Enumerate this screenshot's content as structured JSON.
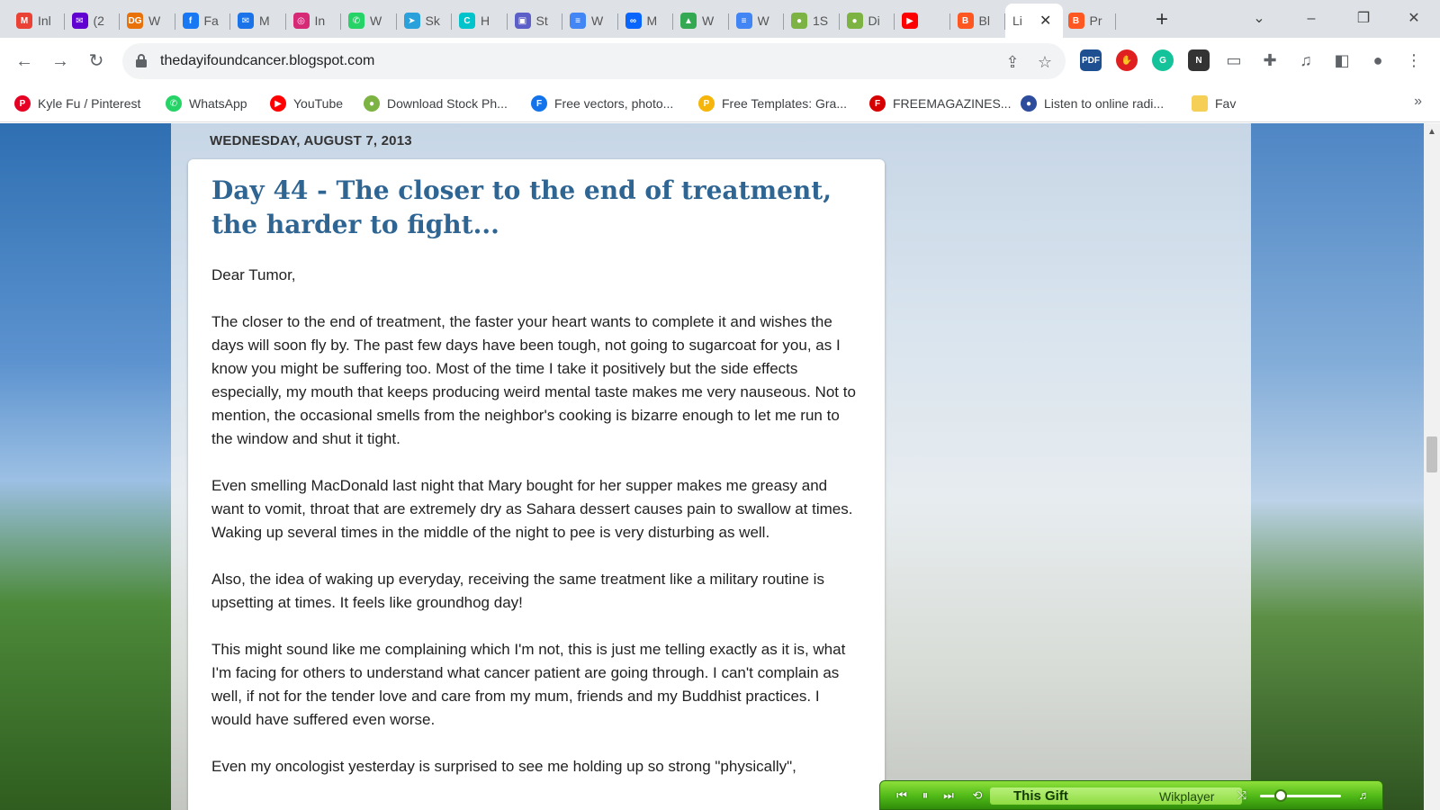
{
  "browser": {
    "tabs": [
      {
        "title": "Inl",
        "icon": "gmail-icon",
        "color": "#ea4335",
        "glyph": "M"
      },
      {
        "title": "(2",
        "icon": "yahoo-mail-icon",
        "color": "#6001d2",
        "glyph": "✉"
      },
      {
        "title": "W",
        "icon": "dg-icon",
        "color": "#e8710a",
        "glyph": "DG"
      },
      {
        "title": "Fa",
        "icon": "facebook-icon",
        "color": "#1877f2",
        "glyph": "f"
      },
      {
        "title": "M",
        "icon": "mail-icon",
        "color": "#1a73e8",
        "glyph": "✉"
      },
      {
        "title": "In",
        "icon": "instagram-icon",
        "color": "#d62976",
        "glyph": "◎"
      },
      {
        "title": "W",
        "icon": "whatsapp-icon",
        "color": "#25d366",
        "glyph": "✆"
      },
      {
        "title": "Sk",
        "icon": "telegram-icon",
        "color": "#2aa1da",
        "glyph": "➤"
      },
      {
        "title": "H",
        "icon": "canva-icon",
        "color": "#00c4cc",
        "glyph": "C"
      },
      {
        "title": "St",
        "icon": "image-icon",
        "color": "#5b5fc7",
        "glyph": "▣"
      },
      {
        "title": "W",
        "icon": "docs-icon",
        "color": "#4285f4",
        "glyph": "≡"
      },
      {
        "title": "M",
        "icon": "meta-icon",
        "color": "#0866ff",
        "glyph": "∞"
      },
      {
        "title": "W",
        "icon": "drive-icon",
        "color": "#34a853",
        "glyph": "▲"
      },
      {
        "title": "W",
        "icon": "docs-icon",
        "color": "#4285f4",
        "glyph": "≡"
      },
      {
        "title": "1S",
        "icon": "leaf-icon",
        "color": "#7cb342",
        "glyph": "●"
      },
      {
        "title": "Di",
        "icon": "leaf-icon",
        "color": "#7cb342",
        "glyph": "●"
      },
      {
        "title": "",
        "icon": "youtube-icon",
        "color": "#ff0000",
        "glyph": "▶"
      },
      {
        "title": "Bl",
        "icon": "blogger-icon",
        "color": "#ff5722",
        "glyph": "B"
      },
      {
        "title": "Li",
        "icon": "",
        "color": "",
        "glyph": ""
      },
      {
        "title": "Pr",
        "icon": "blogger-icon",
        "color": "#ff5722",
        "glyph": "B"
      }
    ],
    "url": "thedayifoundcancer.blogspot.com",
    "bookmarks": [
      {
        "label": "Kyle Fu / Pinterest",
        "icon": "pinterest-icon",
        "color": "#e60023",
        "glyph": "P"
      },
      {
        "label": "WhatsApp",
        "icon": "whatsapp-icon",
        "color": "#25d366",
        "glyph": "✆"
      },
      {
        "label": "YouTube",
        "icon": "youtube-icon",
        "color": "#ff0000",
        "glyph": "▶"
      },
      {
        "label": "Download Stock Ph...",
        "icon": "leaf-icon",
        "color": "#7cb342",
        "glyph": "●"
      },
      {
        "label": "Free vectors, photo...",
        "icon": "freepik-icon",
        "color": "#1273eb",
        "glyph": "F"
      },
      {
        "label": "Free Templates: Gra...",
        "icon": "template-icon",
        "color": "#f5b50a",
        "glyph": "P"
      },
      {
        "label": "FREEMAGAZINES...",
        "icon": "magazine-icon",
        "color": "#d60000",
        "glyph": "F"
      },
      {
        "label": "Listen to online radi...",
        "icon": "radio-flag-icon",
        "color": "#2d4c9b",
        "glyph": "●"
      },
      {
        "label": "Fav",
        "icon": "folder-icon",
        "color": "#f6cf57",
        "glyph": ""
      }
    ]
  },
  "post": {
    "date_header": "WEDNESDAY, AUGUST 7, 2013",
    "title": "Day 44 - The closer to the end of treatment, the harder to fight...",
    "paragraphs": [
      "Dear Tumor,",
      "The closer to the end of treatment, the faster your heart wants to complete it and wishes the days will soon fly by. The past few days have been tough, not going to sugarcoat for you, as I know you might be suffering too. Most of the time I take it positively but the side effects especially, my mouth that keeps producing weird mental taste makes me very nauseous. Not to mention, the occasional smells from the neighbor's cooking is bizarre enough to let me run to the window and shut it tight.",
      "Even smelling MacDonald last night that Mary bought for her supper makes me greasy and want to vomit, throat that are extremely dry as Sahara dessert causes pain to swallow at times. Waking up several times in the middle of the night to pee is very disturbing as well.",
      "Also, the idea of waking up everyday, receiving the same treatment like a military routine is upsetting at times. It feels like groundhog day!",
      "This might sound like me complaining which I'm not, this is just me telling exactly as it is, what I'm facing for others to understand what cancer patient are going through. I can't complain as well, if not for the tender love and care from my mum, friends and my Buddhist practices. I would have suffered even worse.",
      "Even my oncologist yesterday is surprised to see me holding up so strong \"physically\","
    ]
  },
  "player": {
    "song": "This Gift",
    "brand": "Wikplayer",
    "volume": 0.25
  }
}
